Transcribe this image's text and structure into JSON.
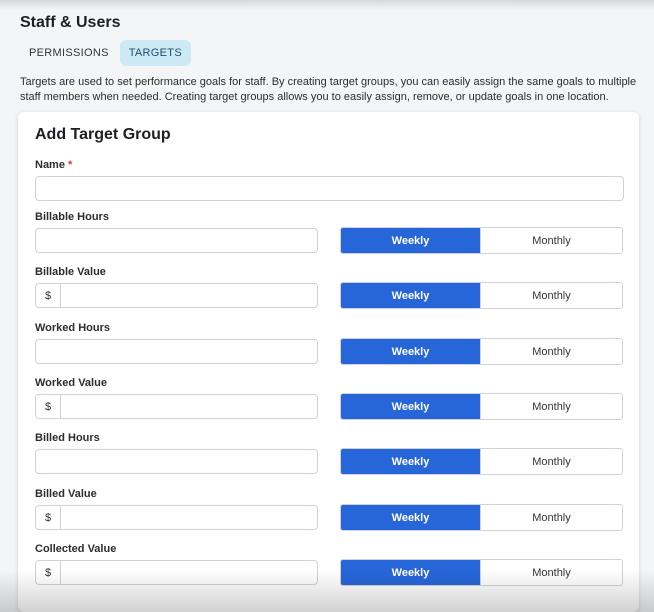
{
  "header": {
    "title": "Staff & Users"
  },
  "tabs": [
    {
      "label": "PERMISSIONS",
      "active": false
    },
    {
      "label": "TARGETS",
      "active": true
    }
  ],
  "description": "Targets are used to set performance goals for staff. By creating target groups, you can easily assign the same goals to multiple staff members when needed. Creating target groups allows you to easily assign, remove, or update goals in one location.",
  "form": {
    "title": "Add Target Group",
    "name_label": "Name",
    "required_marker": "*",
    "name_value": "",
    "fields": [
      {
        "label": "Billable Hours",
        "prefix": "",
        "value": "",
        "period_options": [
          "Weekly",
          "Monthly"
        ],
        "selected": "Weekly"
      },
      {
        "label": "Billable Value",
        "prefix": "$",
        "value": "",
        "period_options": [
          "Weekly",
          "Monthly"
        ],
        "selected": "Weekly"
      },
      {
        "label": "Worked Hours",
        "prefix": "",
        "value": "",
        "period_options": [
          "Weekly",
          "Monthly"
        ],
        "selected": "Weekly"
      },
      {
        "label": "Worked Value",
        "prefix": "$",
        "value": "",
        "period_options": [
          "Weekly",
          "Monthly"
        ],
        "selected": "Weekly"
      },
      {
        "label": "Billed Hours",
        "prefix": "",
        "value": "",
        "period_options": [
          "Weekly",
          "Monthly"
        ],
        "selected": "Weekly"
      },
      {
        "label": "Billed Value",
        "prefix": "$",
        "value": "",
        "period_options": [
          "Weekly",
          "Monthly"
        ],
        "selected": "Weekly"
      },
      {
        "label": "Collected Value",
        "prefix": "$",
        "value": "",
        "period_options": [
          "Weekly",
          "Monthly"
        ],
        "selected": "Weekly"
      }
    ]
  },
  "colors": {
    "accent": "#2766d9",
    "active_tab_bg": "#cde9f6",
    "required": "#e0353a"
  }
}
